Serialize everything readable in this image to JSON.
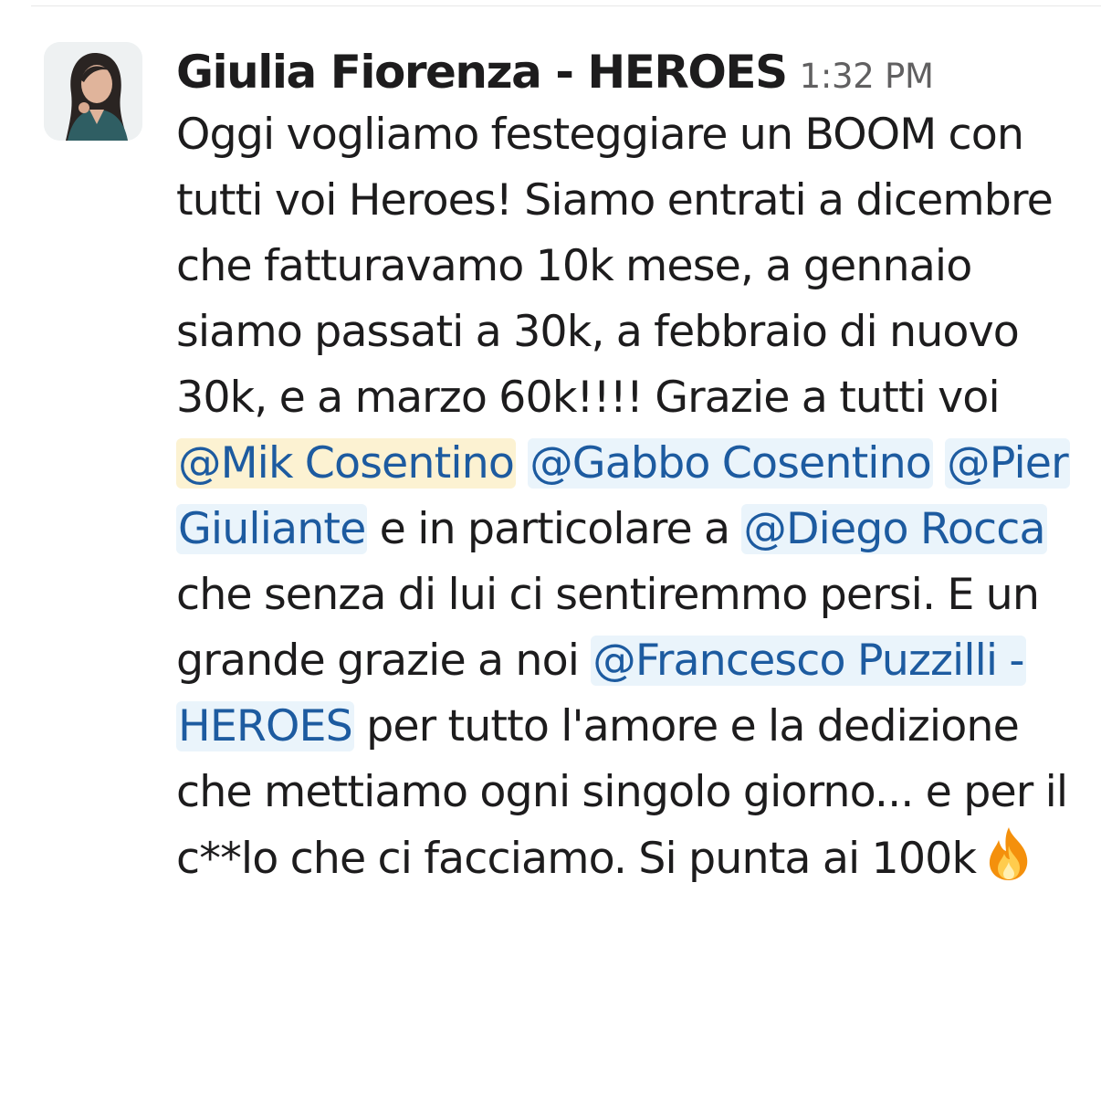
{
  "message": {
    "sender": "Giulia Fiorenza - HEROES",
    "time": "1:32 PM",
    "parts": {
      "t1": "Oggi vogliamo festeggiare un BOOM con tutti voi Heroes! Siamo entrati a dicembre che fatturavamo 10k mese, a gennaio siamo passati a 30k, a febbraio di nuovo 30k, e a marzo 60k!!!! Grazie a tutti voi ",
      "m1": "@Mik Cosentino",
      "t2": " ",
      "m2": "@Gabbo Cosentino",
      "t3": " ",
      "m3": "@Pier Giuliante",
      "t4": " e in particolare a ",
      "m4": "@Diego Rocca",
      "t5": " che senza di lui ci sentiremmo persi. E un grande grazie a noi ",
      "m5": "@Francesco Puzzilli - HEROES",
      "t6": " per tutto l'amore e la dedizione che mettiamo ogni singolo giorno... e per il c**lo che ci facciamo. Si punta ai 100k"
    },
    "emoji": "fire-emoji"
  },
  "colors": {
    "mention_text": "#1d5ba0",
    "mention_bg": "#eaf4fb",
    "self_mention_bg": "#fcf2d2",
    "timestamp": "#616061"
  }
}
